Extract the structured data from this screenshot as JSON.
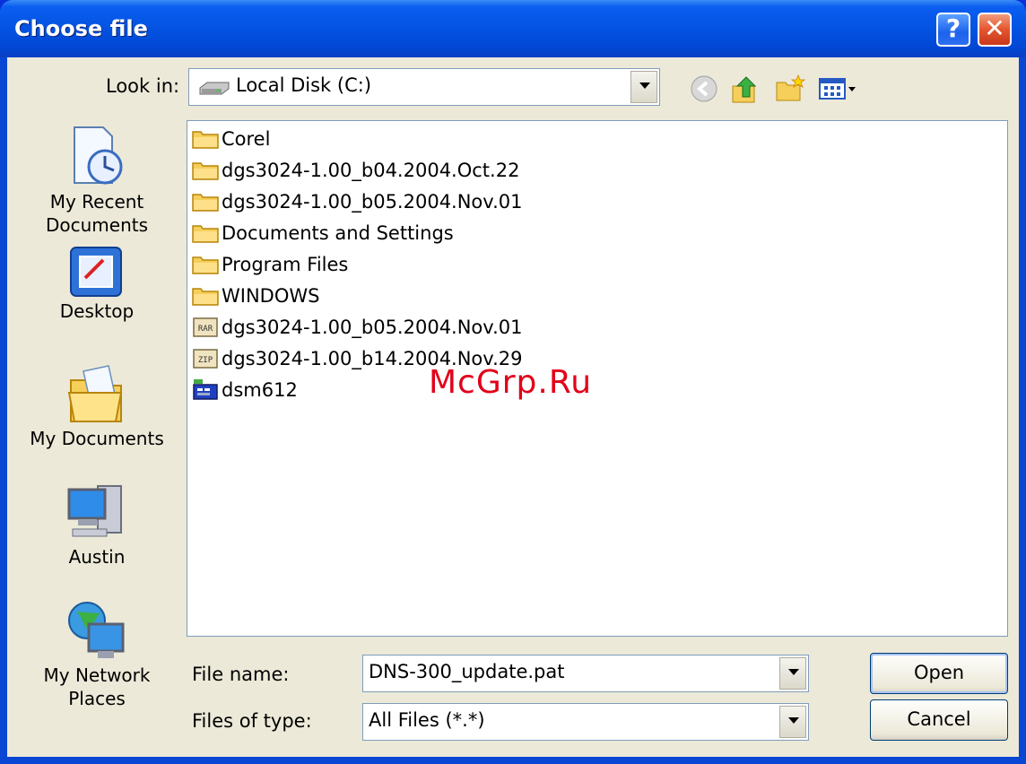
{
  "window": {
    "title": "Choose file",
    "help_label": "?",
    "close_label": "✕"
  },
  "lookin": {
    "label": "Look in:",
    "value": "Local Disk (C:)"
  },
  "places": [
    {
      "label_1": "My Recent",
      "label_2": "Documents"
    },
    {
      "label_1": "Desktop"
    },
    {
      "label_1": "My Documents"
    },
    {
      "label_1": "Austin"
    },
    {
      "label_1": "My Network",
      "label_2": "Places"
    }
  ],
  "files": [
    {
      "name": "Corel",
      "type": "folder"
    },
    {
      "name": "dgs3024-1.00_b04.2004.Oct.22",
      "type": "folder"
    },
    {
      "name": "dgs3024-1.00_b05.2004.Nov.01",
      "type": "folder"
    },
    {
      "name": "Documents and Settings",
      "type": "folder"
    },
    {
      "name": "Program Files",
      "type": "folder"
    },
    {
      "name": "WINDOWS",
      "type": "folder"
    },
    {
      "name": "dgs3024-1.00_b05.2004.Nov.01",
      "type": "rar"
    },
    {
      "name": "dgs3024-1.00_b14.2004.Nov.29",
      "type": "zip"
    },
    {
      "name": "dsm612",
      "type": "app"
    }
  ],
  "filename": {
    "label": "File name:",
    "value": "DNS-300_update.pat"
  },
  "filetype": {
    "label": "Files of type:",
    "value": "All Files (*.*)"
  },
  "buttons": {
    "open": "Open",
    "cancel": "Cancel"
  },
  "watermark": "McGrp.Ru",
  "colors": {
    "titlebar": "#0554e3",
    "dialog_bg": "#ece9d8",
    "folder": "#f5cf5a",
    "watermark": "#e2001a"
  }
}
